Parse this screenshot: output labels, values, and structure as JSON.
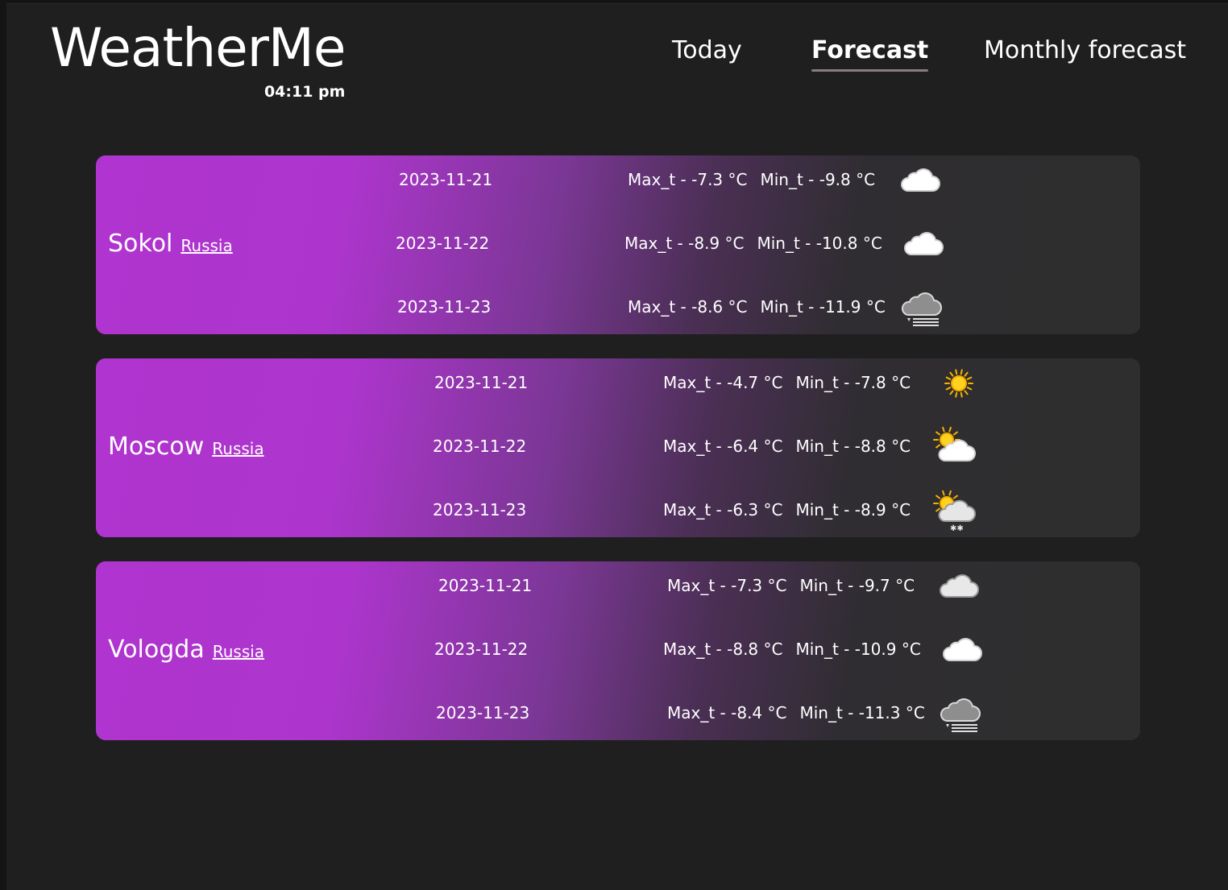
{
  "app": {
    "name": "WeatherMe",
    "time": "04:11 pm"
  },
  "nav": {
    "today": "Today",
    "forecast": "Forecast",
    "monthly": "Monthly forecast",
    "active": "forecast"
  },
  "colors": {
    "card_gradient_start": "#b034cf",
    "card_gradient_end": "#2e2e2e",
    "background": "#1f1f1f"
  },
  "cities": [
    {
      "name": "Sokol",
      "country": "Russia",
      "days": [
        {
          "date": "2023-11-21",
          "max": "Max_t - -7.3 °C",
          "min": "Min_t - -9.8 °C",
          "icon": "cloud-icon"
        },
        {
          "date": "2023-11-22",
          "max": "Max_t - -8.9 °C",
          "min": "Min_t - -10.8 °C",
          "icon": "cloud-icon"
        },
        {
          "date": "2023-11-23",
          "max": "Max_t - -8.6 °C",
          "min": "Min_t - -11.9 °C",
          "icon": "fog-cloud-icon"
        }
      ]
    },
    {
      "name": "Moscow",
      "country": "Russia",
      "days": [
        {
          "date": "2023-11-21",
          "max": "Max_t - -4.7 °C",
          "min": "Min_t - -7.8 °C",
          "icon": "sun-icon"
        },
        {
          "date": "2023-11-22",
          "max": "Max_t - -6.4 °C",
          "min": "Min_t - -8.8 °C",
          "icon": "partly-cloudy-icon"
        },
        {
          "date": "2023-11-23",
          "max": "Max_t - -6.3 °C",
          "min": "Min_t - -8.9 °C",
          "icon": "sun-cloud-snow-icon"
        }
      ]
    },
    {
      "name": "Vologda",
      "country": "Russia",
      "days": [
        {
          "date": "2023-11-21",
          "max": "Max_t - -7.3 °C",
          "min": "Min_t - -9.7 °C",
          "icon": "overcast-cloud-icon"
        },
        {
          "date": "2023-11-22",
          "max": "Max_t - -8.8 °C",
          "min": "Min_t - -10.9 °C",
          "icon": "cloud-icon"
        },
        {
          "date": "2023-11-23",
          "max": "Max_t - -8.4 °C",
          "min": "Min_t - -11.3 °C",
          "icon": "fog-cloud-icon"
        }
      ]
    }
  ]
}
